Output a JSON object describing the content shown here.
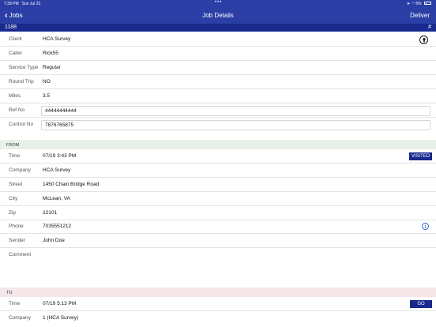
{
  "status_bar": {
    "time": "7:39 PM",
    "date": "Sun Jul 23",
    "battery": "5%"
  },
  "nav": {
    "back_label": "Jobs",
    "title": "Job Details",
    "action_label": "Deliver"
  },
  "job": {
    "id": "1188",
    "hash": "#"
  },
  "fields": {
    "client": {
      "label": "Client",
      "value": "HCA Survey"
    },
    "caller": {
      "label": "Caller",
      "value": "Rick55"
    },
    "service_type": {
      "label": "Service Type",
      "value": "Regular"
    },
    "round_trip": {
      "label": "Round Trip",
      "value": "NO"
    },
    "miles": {
      "label": "Miles",
      "value": "3.5"
    },
    "ref_no": {
      "label": "Ref No",
      "value": "44444444444"
    },
    "control_no": {
      "label": "Control No",
      "value": "7876765875"
    }
  },
  "from": {
    "header": "FROM",
    "time": {
      "label": "Time",
      "value": "07/19 3:43 PM",
      "badge": "VISITED"
    },
    "company": {
      "label": "Company",
      "value": "HCA Survey"
    },
    "street": {
      "label": "Street",
      "value": "1450 Chain Bridge Road"
    },
    "city": {
      "label": "City",
      "value": "McLean, VA"
    },
    "zip": {
      "label": "Zip",
      "value": "22101"
    },
    "phone": {
      "label": "Phone",
      "value": "7035551212"
    },
    "sender": {
      "label": "Sender",
      "value": "John Doe"
    },
    "comment": {
      "label": "Comment",
      "value": ""
    }
  },
  "to": {
    "header": "TO",
    "time": {
      "label": "Time",
      "value": "07/19 5:13 PM",
      "badge": "GO"
    },
    "company": {
      "label": "Company",
      "value": "1 (HCA Survey)"
    }
  },
  "colors": {
    "nav_bg": "#2b3ea5",
    "id_bar_bg": "#182a8e",
    "badge_bg": "#18288e",
    "from_header_bg": "#e7f1e9",
    "to_header_bg": "#f4e6e9",
    "info_blue": "#2a66d6"
  },
  "icons": {
    "upload": "arrow-up-circle-icon",
    "info": "info-circle-icon",
    "back": "chevron-left-icon"
  }
}
